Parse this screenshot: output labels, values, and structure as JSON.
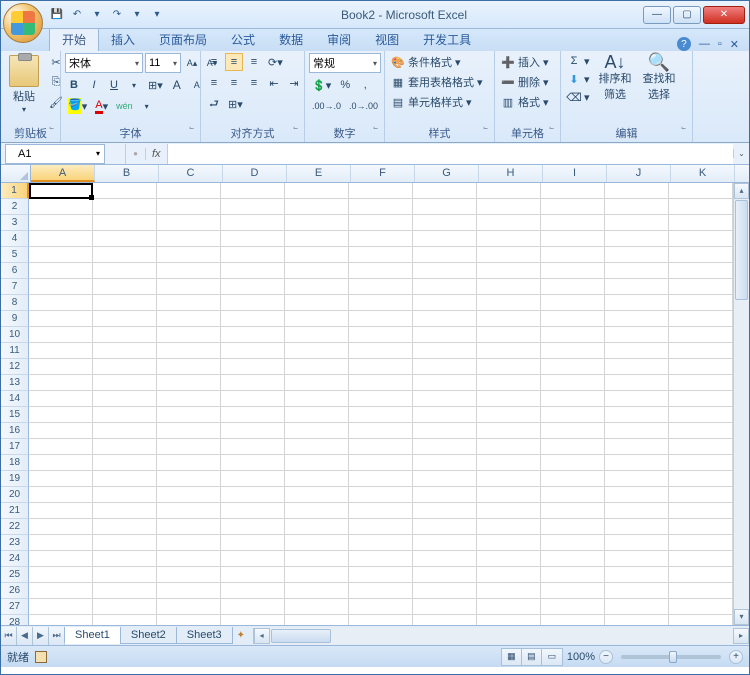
{
  "title": "Book2 - Microsoft Excel",
  "qat": {
    "save": "💾",
    "undo": "↶",
    "redo": "↷"
  },
  "tabs": {
    "items": [
      "开始",
      "插入",
      "页面布局",
      "公式",
      "数据",
      "审阅",
      "视图",
      "开发工具"
    ],
    "active": 0
  },
  "ribbon": {
    "clipboard": {
      "paste": "粘贴",
      "label": "剪贴板"
    },
    "font": {
      "name": "宋体",
      "size": "11",
      "bold": "B",
      "italic": "I",
      "underline": "U",
      "label": "字体"
    },
    "alignment": {
      "label": "对齐方式"
    },
    "number": {
      "format": "常规",
      "label": "数字"
    },
    "styles": {
      "conditional": "条件格式",
      "table": "套用表格格式",
      "cell": "单元格样式",
      "label": "样式"
    },
    "cells": {
      "insert": "插入",
      "delete": "删除",
      "format": "格式",
      "label": "单元格"
    },
    "editing": {
      "sort": "排序和\n筛选",
      "find": "查找和\n选择",
      "label": "编辑"
    }
  },
  "formula": {
    "nameBox": "A1",
    "fx": "fx"
  },
  "columns": [
    "A",
    "B",
    "C",
    "D",
    "E",
    "F",
    "G",
    "H",
    "I",
    "J",
    "K"
  ],
  "rows": [
    1,
    2,
    3,
    4,
    5,
    6,
    7,
    8,
    9,
    10,
    11,
    12,
    13,
    14,
    15,
    16,
    17,
    18,
    19,
    20,
    21,
    22,
    23,
    24,
    25,
    26,
    27,
    28
  ],
  "sheets": {
    "items": [
      "Sheet1",
      "Sheet2",
      "Sheet3"
    ],
    "active": 0
  },
  "status": {
    "ready": "就绪",
    "zoom": "100%"
  }
}
